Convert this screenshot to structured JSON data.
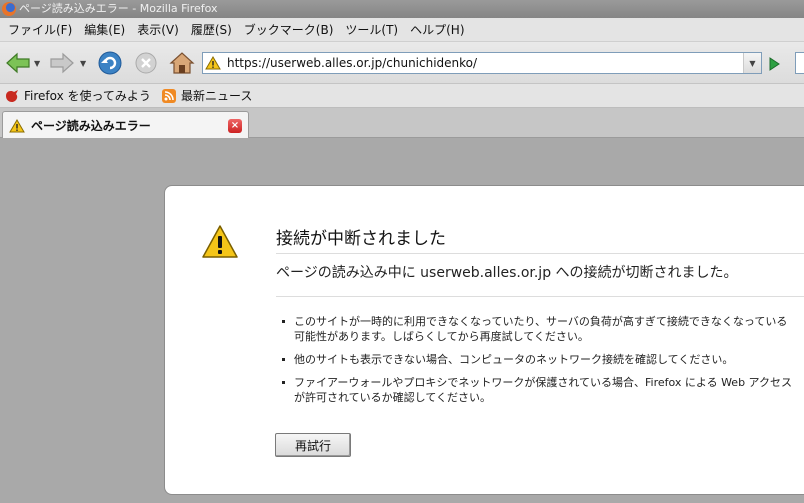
{
  "window": {
    "title": "ページ読み込みエラー - Mozilla Firefox"
  },
  "menubar": {
    "items": [
      {
        "label": "ファイル(F)"
      },
      {
        "label": "編集(E)"
      },
      {
        "label": "表示(V)"
      },
      {
        "label": "履歴(S)"
      },
      {
        "label": "ブックマーク(B)"
      },
      {
        "label": "ツール(T)"
      },
      {
        "label": "ヘルプ(H)"
      }
    ]
  },
  "navbar": {
    "url": "https://userweb.alles.or.jp/chunichidenko/",
    "icons": [
      "back-icon",
      "forward-icon",
      "reload-icon",
      "stop-icon",
      "home-icon",
      "warning-icon",
      "go-icon"
    ]
  },
  "bookmarks": {
    "items": [
      {
        "label": "Firefox を使ってみよう",
        "icon": "firefox-bookmark-icon"
      },
      {
        "label": "最新ニュース",
        "icon": "rss-icon"
      }
    ]
  },
  "tab": {
    "label": "ページ読み込みエラー"
  },
  "error": {
    "title": "接続が中断されました",
    "short_desc": "ページの読み込み中に userweb.alles.or.jp への接続が切断されました。",
    "bullets": [
      "このサイトが一時的に利用できなくなっていたり、サーバの負荷が高すぎて接続できなくなっている可能性があります。しばらくしてから再度試してください。",
      "他のサイトも表示できない場合、コンピュータのネットワーク接続を確認してください。",
      "ファイアーウォールやプロキシでネットワークが保護されている場合、Firefox による Web アクセスが許可されているか確認してください。"
    ],
    "retry_label": "再試行"
  },
  "colors": {
    "accent_blue": "#3b82c4",
    "go_green": "#2ea043",
    "warning_yellow": "#f5c518"
  }
}
